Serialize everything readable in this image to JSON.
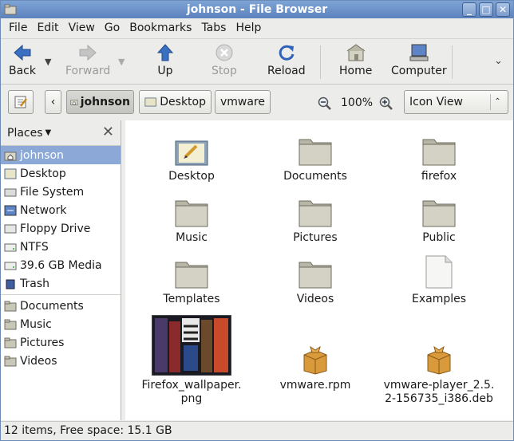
{
  "window": {
    "title": "johnson - File Browser"
  },
  "menubar": [
    "File",
    "Edit",
    "View",
    "Go",
    "Bookmarks",
    "Tabs",
    "Help"
  ],
  "toolbar": {
    "back": "Back",
    "forward": "Forward",
    "up": "Up",
    "stop": "Stop",
    "reload": "Reload",
    "home": "Home",
    "computer": "Computer"
  },
  "location": {
    "path": [
      "johnson",
      "Desktop",
      "vmware"
    ],
    "zoom": "100%",
    "view_mode": "Icon View"
  },
  "sidebar": {
    "header": "Places",
    "places": [
      {
        "label": "johnson",
        "icon": "home-icon"
      },
      {
        "label": "Desktop",
        "icon": "desktop-icon"
      },
      {
        "label": "File System",
        "icon": "filesystem-icon"
      },
      {
        "label": "Network",
        "icon": "network-icon"
      },
      {
        "label": "Floppy Drive",
        "icon": "floppy-icon"
      },
      {
        "label": "NTFS",
        "icon": "drive-icon"
      },
      {
        "label": "39.6 GB Media",
        "icon": "drive-icon"
      },
      {
        "label": "Trash",
        "icon": "trash-icon"
      }
    ],
    "bookmarks": [
      {
        "label": "Documents",
        "icon": "folder-icon"
      },
      {
        "label": "Music",
        "icon": "folder-icon"
      },
      {
        "label": "Pictures",
        "icon": "folder-icon"
      },
      {
        "label": "Videos",
        "icon": "folder-icon"
      }
    ]
  },
  "files": [
    {
      "name": "Desktop",
      "type": "desktop-folder"
    },
    {
      "name": "Documents",
      "type": "folder"
    },
    {
      "name": "firefox",
      "type": "folder"
    },
    {
      "name": "Music",
      "type": "folder"
    },
    {
      "name": "Pictures",
      "type": "folder"
    },
    {
      "name": "Public",
      "type": "folder"
    },
    {
      "name": "Templates",
      "type": "folder"
    },
    {
      "name": "Videos",
      "type": "folder"
    },
    {
      "name": "Examples",
      "type": "document"
    },
    {
      "name": "Firefox_wallpaper.\npng",
      "type": "image"
    },
    {
      "name": "vmware.rpm",
      "type": "package"
    },
    {
      "name": "vmware-player_2.5.\n2-156735_i386.deb",
      "type": "package"
    }
  ],
  "status": "12 items, Free space: 15.1 GB",
  "colors": {
    "accent": "#8ba8d6",
    "titlebar": "#6a90c8"
  }
}
